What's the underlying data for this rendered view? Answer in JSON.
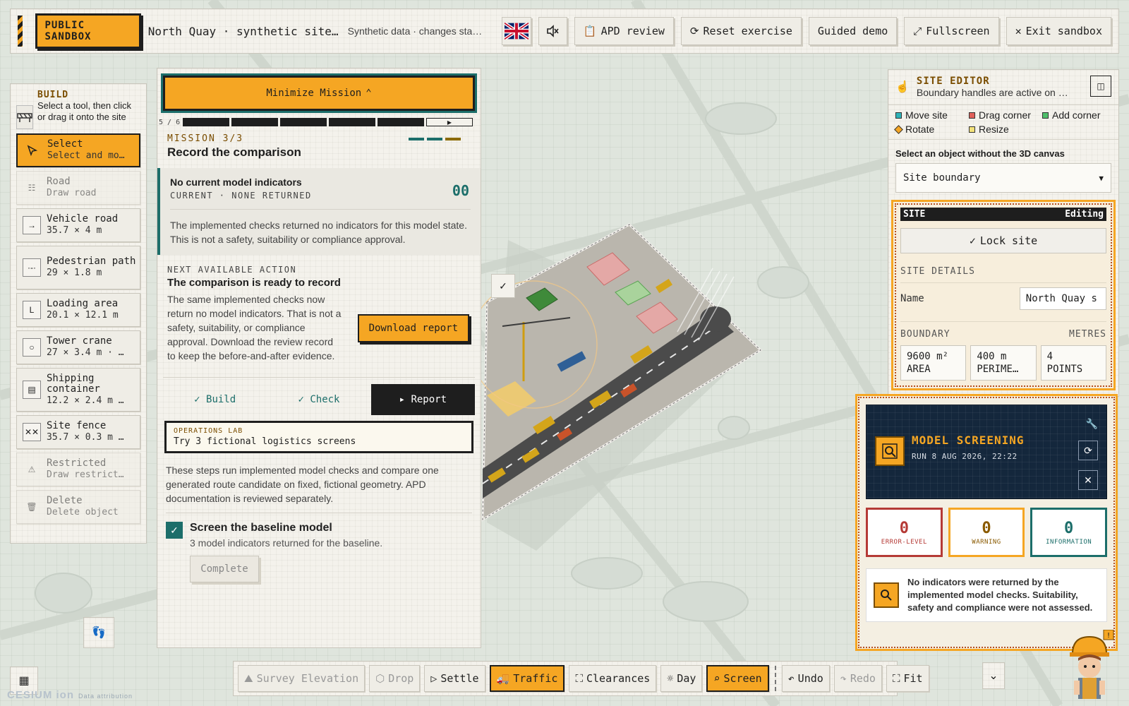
{
  "topbar": {
    "badge": "PUBLIC SANDBOX",
    "title": "North Quay · synthetic site-logi…",
    "subtitle": "Synthetic data · changes sta…",
    "buttons": {
      "apd_review": "APD review",
      "reset": "Reset exercise",
      "guided_demo": "Guided demo",
      "fullscreen": "Fullscreen",
      "exit": "Exit sandbox"
    }
  },
  "build": {
    "title": "BUILD",
    "description": "Select a tool, then click or drag it onto the site",
    "tools": [
      {
        "name": "Select",
        "sub": "Select and mo…",
        "icon": "cursor-icon"
      },
      {
        "name": "Road",
        "sub": "Draw road",
        "icon": "road-icon"
      },
      {
        "name": "Vehicle road",
        "sub": "35.7 × 4 m",
        "icon": "arrow-right-icon"
      },
      {
        "name": "Pedestrian path",
        "sub": "29 × 1.8 m",
        "icon": "dotted-path-icon"
      },
      {
        "name": "Loading area",
        "sub": "20.1 × 12.1 m",
        "icon": "loading-icon"
      },
      {
        "name": "Tower crane",
        "sub": "27 × 3.4 m · …",
        "icon": "crane-icon"
      },
      {
        "name": "Shipping container",
        "sub": "12.2 × 2.4 m …",
        "icon": "container-icon"
      },
      {
        "name": "Site fence",
        "sub": "35.7 × 0.3 m …",
        "icon": "fence-icon"
      },
      {
        "name": "Restricted",
        "sub": "Draw restrict…",
        "icon": "warning-icon"
      },
      {
        "name": "Delete",
        "sub": "Delete object",
        "icon": "trash-icon"
      }
    ]
  },
  "mission": {
    "minimize_label": "Minimize Mission",
    "progress_text": "5 / 6",
    "progress": {
      "done": 5,
      "total": 6
    },
    "kicker": "MISSION 3/3",
    "title": "Record the comparison",
    "indicator": {
      "title": "No current model indicators",
      "sub": "CURRENT · NONE RETURNED",
      "count": "00",
      "body": "The implemented checks returned no indicators for this model state. This is not a safety, suitability or compliance approval."
    },
    "next": {
      "kicker": "NEXT AVAILABLE ACTION",
      "title": "The comparison is ready to record",
      "body": "The same implemented checks now return no model indicators. That is not a safety, suitability, or compliance approval. Download the review record to keep the before-and-after evidence.",
      "button": "Download report"
    },
    "steps": [
      {
        "label": "✓ Build"
      },
      {
        "label": "✓ Check"
      },
      {
        "label": "▸ Report"
      }
    ],
    "ops_lab": {
      "kicker": "OPERATIONS LAB",
      "title": "Try 3 fictional logistics screens"
    },
    "description": "These steps run implemented model checks and compare one generated route candidate on fixed, fictional geometry. APD documentation is reviewed separately.",
    "task": {
      "title": "Screen the baseline model",
      "sub": "3 model indicators returned for the baseline.",
      "button": "Complete"
    }
  },
  "site_editor": {
    "title": "SITE EDITOR",
    "subtitle": "Boundary handles are active on …",
    "legend": [
      {
        "label": "Move site",
        "color": "#2fb3b8"
      },
      {
        "label": "Drag corner",
        "color": "#e0605a"
      },
      {
        "label": "Add corner",
        "color": "#4fbf6a"
      },
      {
        "label": "Rotate",
        "color": "#f5a623"
      },
      {
        "label": "Resize",
        "color": "#f3e27a"
      }
    ],
    "select_label": "Select an object without the 3D canvas",
    "select_value": "Site boundary",
    "site": {
      "label": "SITE",
      "status": "Editing",
      "lock_button": "Lock site",
      "details_label": "SITE DETAILS",
      "name_label": "Name",
      "name_value": "North Quay s",
      "boundary_label": "BOUNDARY",
      "units_label": "METRES",
      "stats": [
        {
          "value": "9600 m²",
          "label": "AREA"
        },
        {
          "value": "400 m",
          "label": "PERIME…"
        },
        {
          "value": "4",
          "label": "POINTS"
        }
      ]
    }
  },
  "screening": {
    "title": "MODEL SCREENING",
    "run": "RUN 8 AUG 2026, 22:22",
    "counts": [
      {
        "value": "0",
        "label": "ERROR-LEVEL"
      },
      {
        "value": "0",
        "label": "WARNING"
      },
      {
        "value": "0",
        "label": "INFORMATION"
      }
    ],
    "message": "No indicators were returned by the implemented model checks. Suitability, safety and compliance were not assessed."
  },
  "bottombar": {
    "buttons": [
      {
        "label": "Survey Elevation",
        "state": "disabled"
      },
      {
        "label": "Drop",
        "state": "disabled"
      },
      {
        "label": "Settle",
        "state": "normal"
      },
      {
        "label": "Traffic",
        "state": "active"
      },
      {
        "label": "Clearances",
        "state": "normal"
      },
      {
        "label": "Day",
        "state": "normal"
      },
      {
        "label": "Screen",
        "state": "active"
      },
      {
        "label": "Undo",
        "state": "normal"
      },
      {
        "label": "Redo",
        "state": "disabled"
      },
      {
        "label": "Fit",
        "state": "normal"
      }
    ]
  },
  "attribution": {
    "logo": "CESIUM ion",
    "text": "Data attribution"
  },
  "colors": {
    "accent": "#f5a623",
    "teal": "#1c6e6a",
    "dark": "#1e1e1e",
    "error": "#b53a36",
    "navy": "#14273c"
  }
}
